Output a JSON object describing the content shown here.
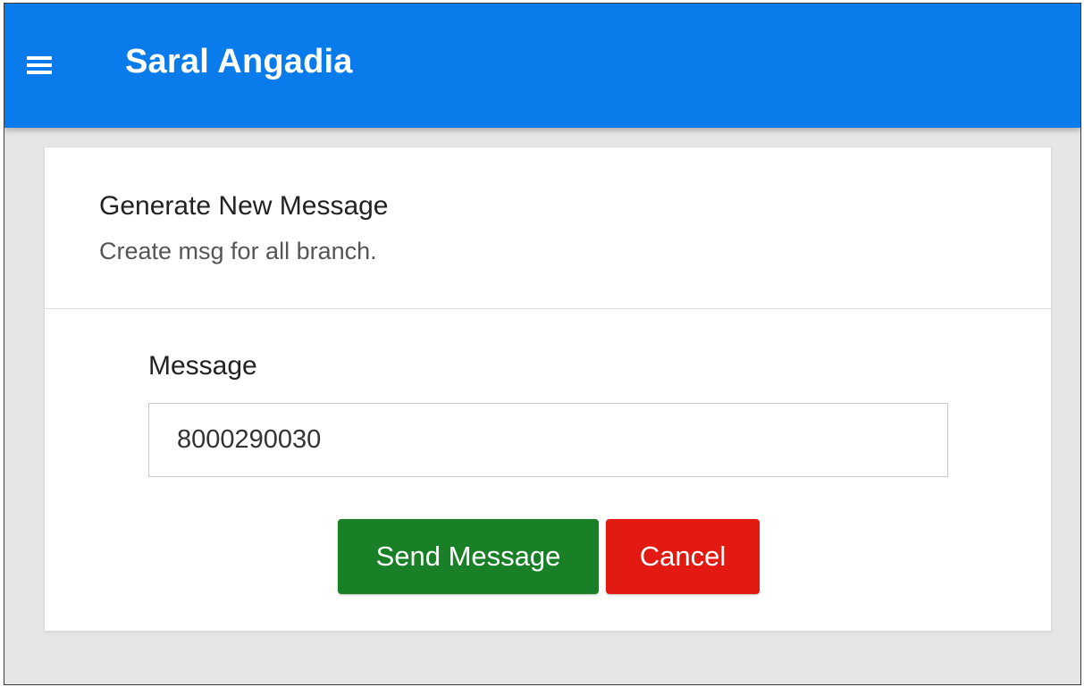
{
  "header": {
    "menu_icon": "hamburger-menu-icon",
    "app_title": "Saral Angadia",
    "background_color": "#0a7bea"
  },
  "card": {
    "title": "Generate New Message",
    "subtitle": "Create msg for all branch."
  },
  "form": {
    "message_label": "Message",
    "message_value": "8000290030",
    "send_label": "Send Message",
    "cancel_label": "Cancel"
  },
  "colors": {
    "send_button": "#1a8027",
    "cancel_button": "#e21a12"
  }
}
